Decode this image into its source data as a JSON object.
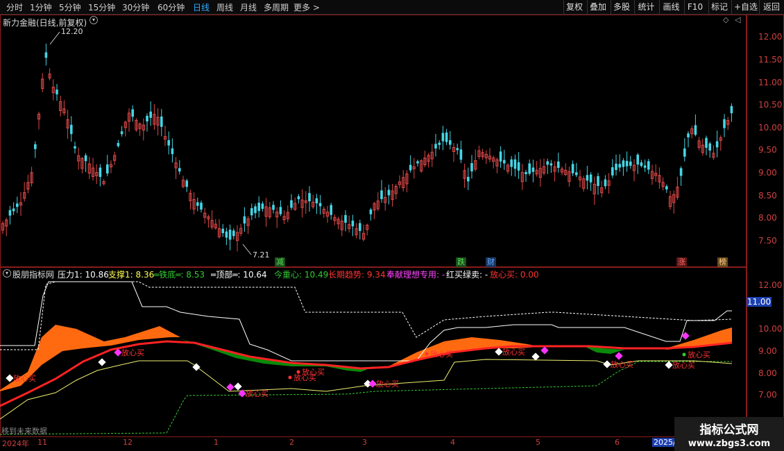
{
  "toolbar": {
    "periods": [
      "分时",
      "1分钟",
      "5分钟",
      "15分钟",
      "30分钟",
      "60分钟",
      "日线",
      "周线",
      "月线",
      "多周期",
      "更多 >"
    ],
    "active_period": "日线",
    "right_buttons": [
      "复权",
      "叠加",
      "多股",
      "统计",
      "画线",
      "F10",
      "标记",
      "+自选",
      "返回"
    ]
  },
  "main": {
    "title": "新力金融(日线,前复权)",
    "high_label": "12.20",
    "low_label": "7.21",
    "events": [
      {
        "text": "减",
        "color": "#2ea043"
      },
      {
        "text": "跌",
        "color": "#2ea043"
      },
      {
        "text": "财",
        "color": "#2f7dd6"
      },
      {
        "text": "涨",
        "color": "#c03030"
      },
      {
        "text": "榜",
        "color": "#c07a2a"
      }
    ]
  },
  "indicator": {
    "name": "股朋指标网",
    "items": [
      {
        "text": "压力1: 10.86",
        "color": "#ffffff"
      },
      {
        "text": "支撑1: 8.36",
        "color": "#ffff55"
      },
      {
        "text": "═铁底═: 8.53",
        "color": "#33cc33"
      },
      {
        "text": "═顶部═: 10.64",
        "color": "#ffffff"
      },
      {
        "text": "今重心: 10.49",
        "color": "#33cc33"
      },
      {
        "text": "长期趋势: 9.34",
        "color": "#ff3333"
      },
      {
        "text": "奉献理想专用: -",
        "color": "#ff44ff"
      },
      {
        "text": "红买绿卖: -",
        "color": "#ffffff"
      },
      {
        "text": "放心买: 0.00",
        "color": "#ff3333"
      }
    ],
    "current_value": "11.00",
    "buy_label": "放心买",
    "future_note": "移到未来数据"
  },
  "price_axis": [
    "12.00",
    "11.50",
    "11.00",
    "10.50",
    "10.00",
    "9.50",
    "9.00",
    "8.50",
    "8.00",
    "7.50"
  ],
  "ind_axis": [
    "12.00",
    "11.00",
    "10.00",
    "9.00",
    "8.00",
    "7.00"
  ],
  "dates": [
    "2024年",
    "11",
    "12",
    "1",
    "2",
    "3",
    "4",
    "5",
    "6",
    "2025/"
  ],
  "watermark": {
    "line1": "指标公式网",
    "line2": "www.zbgs3.com"
  },
  "colors": {
    "up": "#e04848",
    "down": "#44d6e6",
    "border": "#8a1c1c",
    "orange": "#ff6a10",
    "green": "#0a8a0a",
    "trend": "#ff2222",
    "support": "#f0f070",
    "pressure": "#ffffff",
    "magenta": "#ff33ff"
  }
}
